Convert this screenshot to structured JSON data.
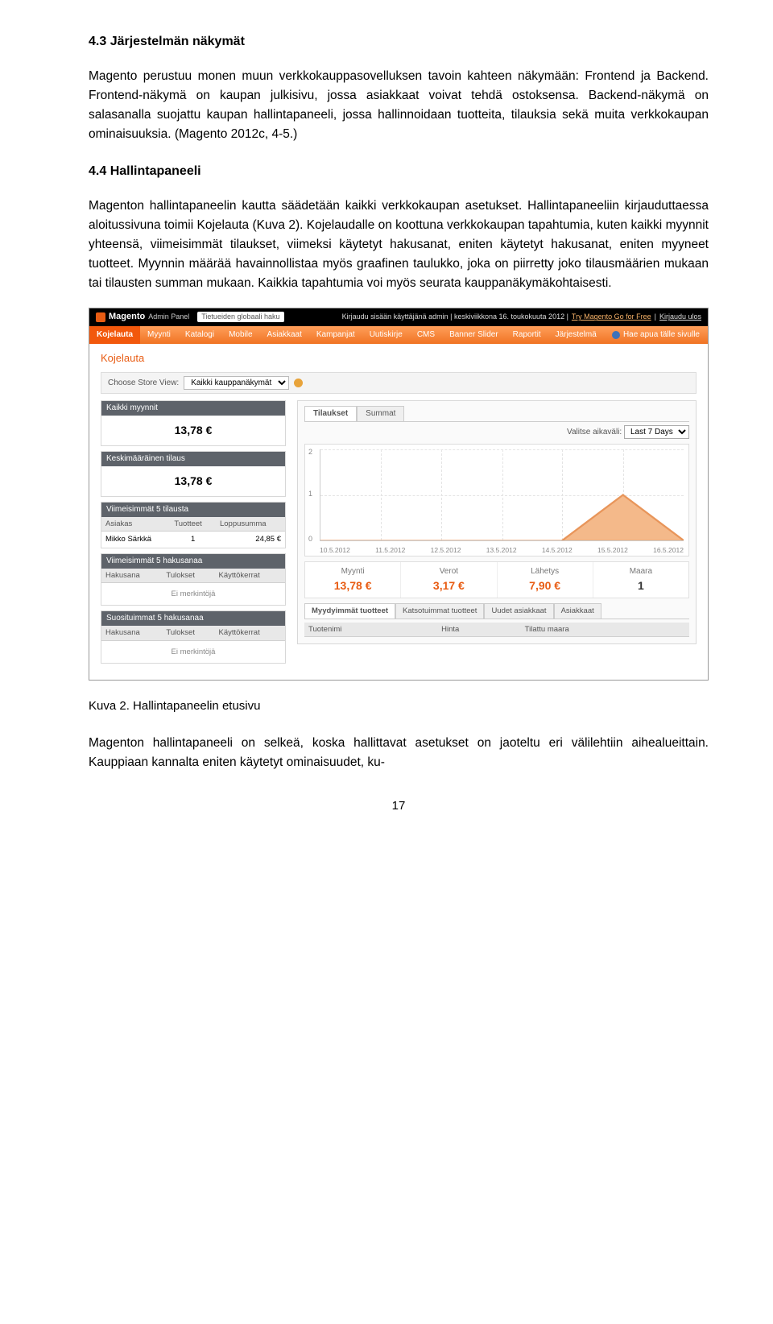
{
  "heading43": "4.3 Järjestelmän näkymät",
  "para1": "Magento perustuu monen muun verkkokauppasovelluksen tavoin kahteen näkymään: Frontend ja Backend. Frontend-näkymä on kaupan julkisivu, jossa asiakkaat voivat tehdä ostoksensa. Backend-näkymä on salasanalla suojattu kaupan hallintapaneeli, jossa hallinnoidaan tuotteita, tilauksia sekä muita verkkokaupan ominaisuuksia. (Magento 2012c, 4-5.)",
  "heading44": "4.4 Hallintapaneeli",
  "para2": "Magenton hallintapaneelin kautta säädetään kaikki verkkokaupan asetukset. Hallintapaneeliin kirjauduttaessa aloitussivuna toimii Kojelauta (Kuva 2). Kojelaudalle on koottuna verkkokaupan tapahtumia, kuten kaikki myynnit yhteensä, viimeisimmät tilaukset, viimeksi käytetyt hakusanat, eniten käytetyt hakusanat, eniten myyneet tuotteet. Myynnin määrää havainnollistaa myös graafinen taulukko, joka on piirretty joko tilausmäärien mukaan tai tilausten summan mukaan. Kaikkia tapahtumia voi myös seurata kauppanäkymäkohtaisesti.",
  "admin": {
    "brand": "Magento",
    "brand_sub": "Admin Panel",
    "search_placeholder": "Tietueiden globaali haku",
    "topinfo": "Kirjaudu sisään käyttäjänä admin | keskiviikkona 16. toukokuuta 2012 |",
    "toplink_try": "Try Magento Go for Free",
    "toplink_logout": "Kirjaudu ulos",
    "menu": [
      "Kojelauta",
      "Myynti",
      "Katalogi",
      "Mobile",
      "Asiakkaat",
      "Kampanjat",
      "Uutiskirje",
      "CMS",
      "Banner Slider",
      "Raportit",
      "Järjestelmä"
    ],
    "help": "Hae apua tälle sivulle",
    "page_title": "Kojelauta",
    "storeview_label": "Choose Store View:",
    "storeview_value": "Kaikki kauppanäkymät",
    "left": {
      "total_sales_head": "Kaikki myynnit",
      "total_sales_value": "13,78 €",
      "avg_order_head": "Keskimääräinen tilaus",
      "avg_order_value": "13,78 €",
      "last_orders_head": "Viimeisimmät 5 tilausta",
      "last_orders_cols": [
        "Asiakas",
        "Tuotteet",
        "Loppusumma"
      ],
      "last_orders_row": [
        "Mikko Särkkä",
        "1",
        "24,85 €"
      ],
      "last_search_head": "Viimeisimmät 5 hakusanaa",
      "pop_search_head": "Suosituimmat 5 hakusanaa",
      "search_cols": [
        "Hakusana",
        "Tulokset",
        "Käyttökerrat"
      ],
      "no_records": "Ei merkintöjä"
    },
    "right": {
      "tabs_top": [
        "Tilaukset",
        "Summat"
      ],
      "range_label": "Valitse aikaväli:",
      "range_value": "Last 7 Days",
      "metrics": [
        {
          "label": "Myynti",
          "value": "13,78 €",
          "accent": true
        },
        {
          "label": "Verot",
          "value": "3,17 €",
          "accent": true
        },
        {
          "label": "Lähetys",
          "value": "7,90 €",
          "accent": true
        },
        {
          "label": "Maara",
          "value": "1",
          "accent": false
        }
      ],
      "tabs_bottom": [
        "Myydyimmät tuotteet",
        "Katsotuimmat tuotteet",
        "Uudet asiakkaat",
        "Asiakkaat"
      ],
      "bottom_cols": [
        "Tuotenimi",
        "Hinta",
        "Tilattu maara"
      ]
    }
  },
  "chart_data": {
    "type": "line",
    "title": "",
    "xlabel": "",
    "ylabel": "",
    "ylim": [
      0,
      2
    ],
    "categories": [
      "10.5.2012",
      "11.5.2012",
      "12.5.2012",
      "13.5.2012",
      "14.5.2012",
      "15.5.2012",
      "16.5.2012"
    ],
    "series": [
      {
        "name": "Tilaukset",
        "values": [
          0,
          0,
          0,
          0,
          0,
          1,
          0
        ]
      }
    ]
  },
  "caption": "Kuva 2. Hallintapaneelin etusivu",
  "para3": "Magenton hallintapaneeli on selkeä, koska hallittavat asetukset on jaoteltu eri välilehtiin aihealueittain. Kauppiaan kannalta eniten käytetyt ominaisuudet, ku-",
  "page_number": "17"
}
